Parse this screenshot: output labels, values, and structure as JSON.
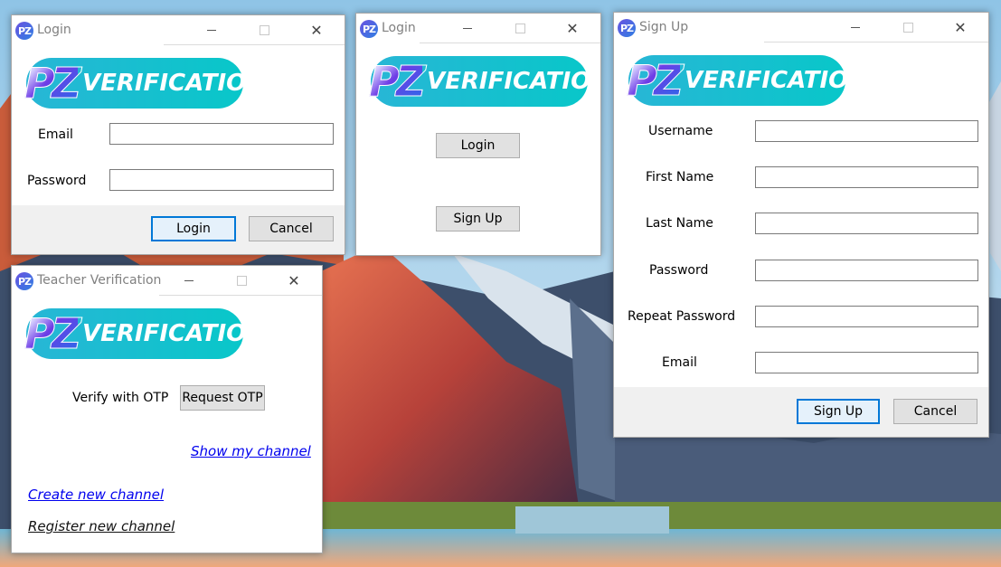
{
  "login_form": {
    "title": "Login",
    "logo": {
      "mark": "PZ",
      "word": "VERIFICATION"
    },
    "email_label": "Email",
    "email_value": "",
    "password_label": "Password",
    "password_value": "",
    "login_button": "Login",
    "cancel_button": "Cancel"
  },
  "start_window": {
    "title": "Login",
    "logo": {
      "mark": "PZ",
      "word": "VERIFICATION"
    },
    "login_button": "Login",
    "signup_button": "Sign Up"
  },
  "signup_form": {
    "title": "Sign Up",
    "logo": {
      "mark": "PZ",
      "word": "VERIFICATION"
    },
    "fields": [
      {
        "label": "Username",
        "value": ""
      },
      {
        "label": "First Name",
        "value": ""
      },
      {
        "label": "Last Name",
        "value": ""
      },
      {
        "label": "Password",
        "value": ""
      },
      {
        "label": "Repeat Password",
        "value": ""
      },
      {
        "label": "Email",
        "value": ""
      }
    ],
    "signup_button": "Sign Up",
    "cancel_button": "Cancel"
  },
  "teacher_window": {
    "title": "Teacher Verification",
    "logo": {
      "mark": "PZ",
      "word": "VERIFICATION"
    },
    "verify_label": "Verify with OTP",
    "request_otp_button": "Request OTP",
    "show_channel_link": "Show my channel",
    "create_channel_link": "Create new channel",
    "register_channel_link": "Register new channel"
  },
  "window_controls": {
    "minimize": "minimize-icon",
    "maximize": "maximize-icon",
    "close": "close-icon"
  },
  "colors": {
    "accent": "#0078d7",
    "logo_teal": "#08c7c9",
    "link": "#0000ee"
  }
}
